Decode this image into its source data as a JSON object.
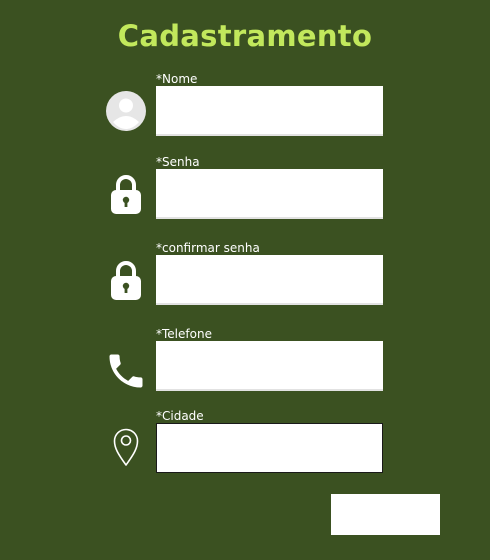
{
  "form": {
    "title": "Cadastramento",
    "fields": [
      {
        "label": "*Nome",
        "value": "",
        "placeholder": "",
        "icon": "user-avatar-icon"
      },
      {
        "label": "*Senha",
        "value": "",
        "placeholder": "",
        "icon": "lock-icon"
      },
      {
        "label": "*confirmar senha",
        "value": "",
        "placeholder": "",
        "icon": "lock-icon"
      },
      {
        "label": "*Telefone",
        "value": "",
        "placeholder": "",
        "icon": "phone-icon"
      },
      {
        "label": "*Cidade",
        "value": "",
        "placeholder": "",
        "icon": "location-pin-icon"
      }
    ],
    "submit_label": ""
  },
  "colors": {
    "background": "#3b5121",
    "title": "#c2e85c",
    "text": "#ffffff",
    "field": "#ffffff"
  }
}
